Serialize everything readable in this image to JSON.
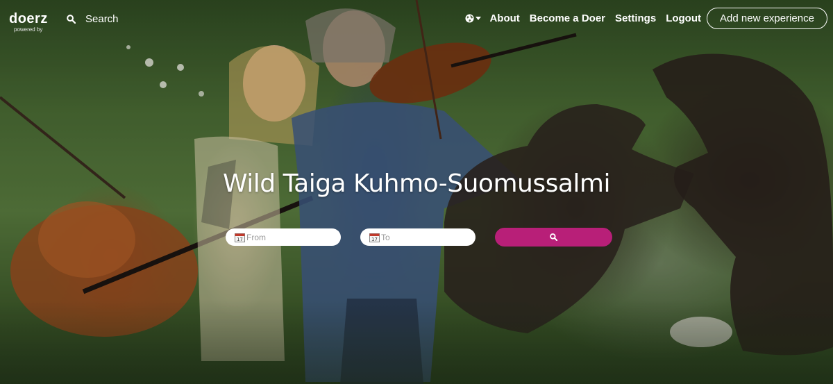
{
  "brand": {
    "name": "doerz",
    "tagline": "powered by"
  },
  "nav": {
    "search_label": "Search",
    "language_icon": "globe-icon",
    "links": [
      "About",
      "Become a Doer",
      "Settings",
      "Logout"
    ],
    "add_button": "Add new experience"
  },
  "hero": {
    "title": "Wild Taiga Kuhmo-Suomussalmi"
  },
  "search_form": {
    "from_placeholder": "From",
    "to_placeholder": "To",
    "calendar_icon": "calendar-icon",
    "submit_icon": "search-icon"
  },
  "colors": {
    "accent": "#b81f78",
    "text_on_image": "#ffffff"
  }
}
